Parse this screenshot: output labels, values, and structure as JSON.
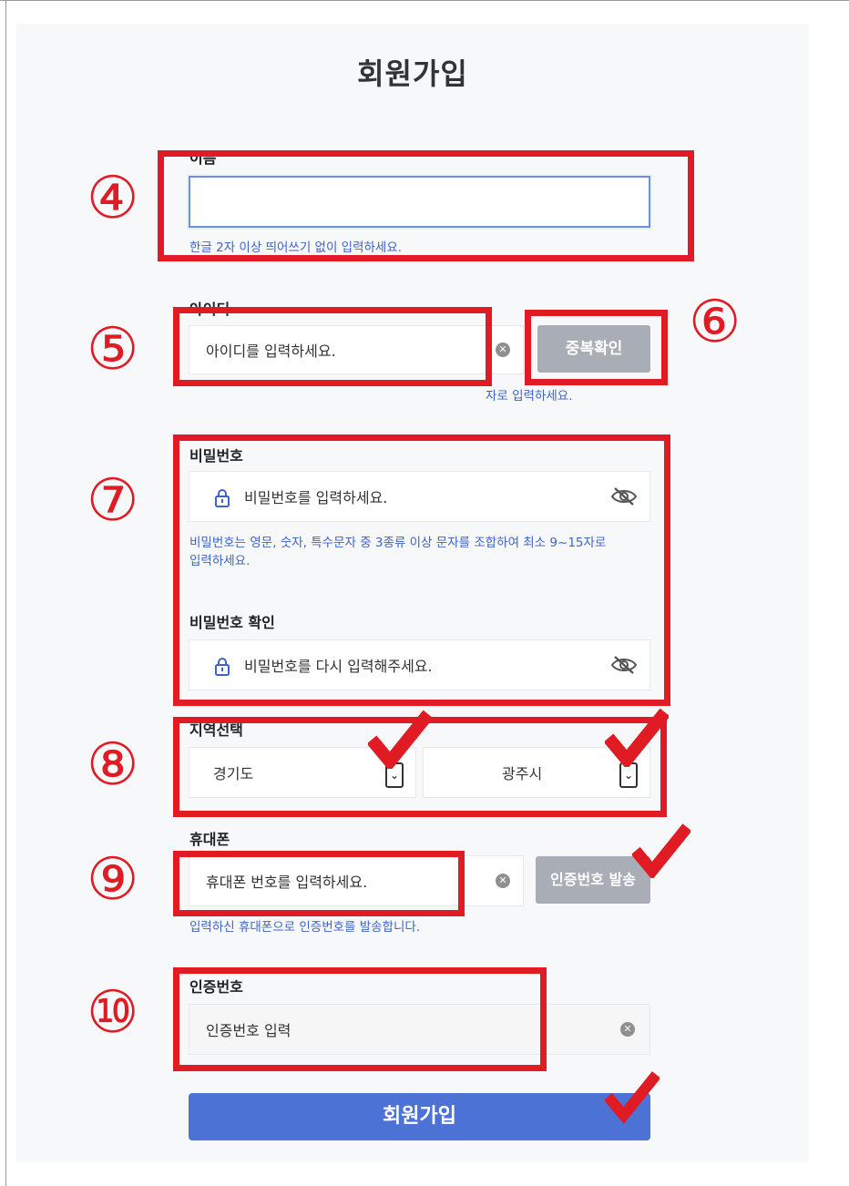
{
  "page": {
    "title": "회원가입"
  },
  "name_field": {
    "label": "이름",
    "hint": "한글 2자 이상 띄어쓰기 없이 입력하세요."
  },
  "id_field": {
    "label": "아이디",
    "placeholder": "아이디를 입력하세요.",
    "dup_check_label": "중복확인",
    "hint": "자로 입력하세요."
  },
  "password_field": {
    "label": "비밀번호",
    "placeholder": "비밀번호를 입력하세요.",
    "hint_line1": "비밀번호는 영문, 숫자, 특수문자 중 3종류 이상 문자를 조합하여 최소 9~15자로",
    "hint_line2": "입력하세요."
  },
  "password_confirm_field": {
    "label": "비밀번호 확인",
    "placeholder": "비밀번호를 다시 입력해주세요."
  },
  "region": {
    "label": "지역선택",
    "province": "경기도",
    "city": "광주시"
  },
  "phone_field": {
    "label": "휴대폰",
    "placeholder": "휴대폰 번호를 입력하세요.",
    "send_code_label": "인증번호 발송",
    "hint": "입력하신 휴대폰으로 인증번호를 발송합니다."
  },
  "verify_field": {
    "label": "인증번호",
    "placeholder": "인증번호 입력"
  },
  "submit": {
    "label": "회원가입"
  },
  "annotations": {
    "n4": "④",
    "n5": "⑤",
    "n6": "⑥",
    "n7": "⑦",
    "n8": "⑧",
    "n9": "⑨",
    "n10": "⑩"
  },
  "colors": {
    "annotation_red": "#e01b24",
    "primary_blue": "#4d72d6",
    "hint_blue": "#3f63c8",
    "disabled_gray": "#a9adb6"
  },
  "icons": [
    "lock-icon",
    "eye-off-icon",
    "clear-icon",
    "chevron-down-icon",
    "check-mark-icon"
  ]
}
